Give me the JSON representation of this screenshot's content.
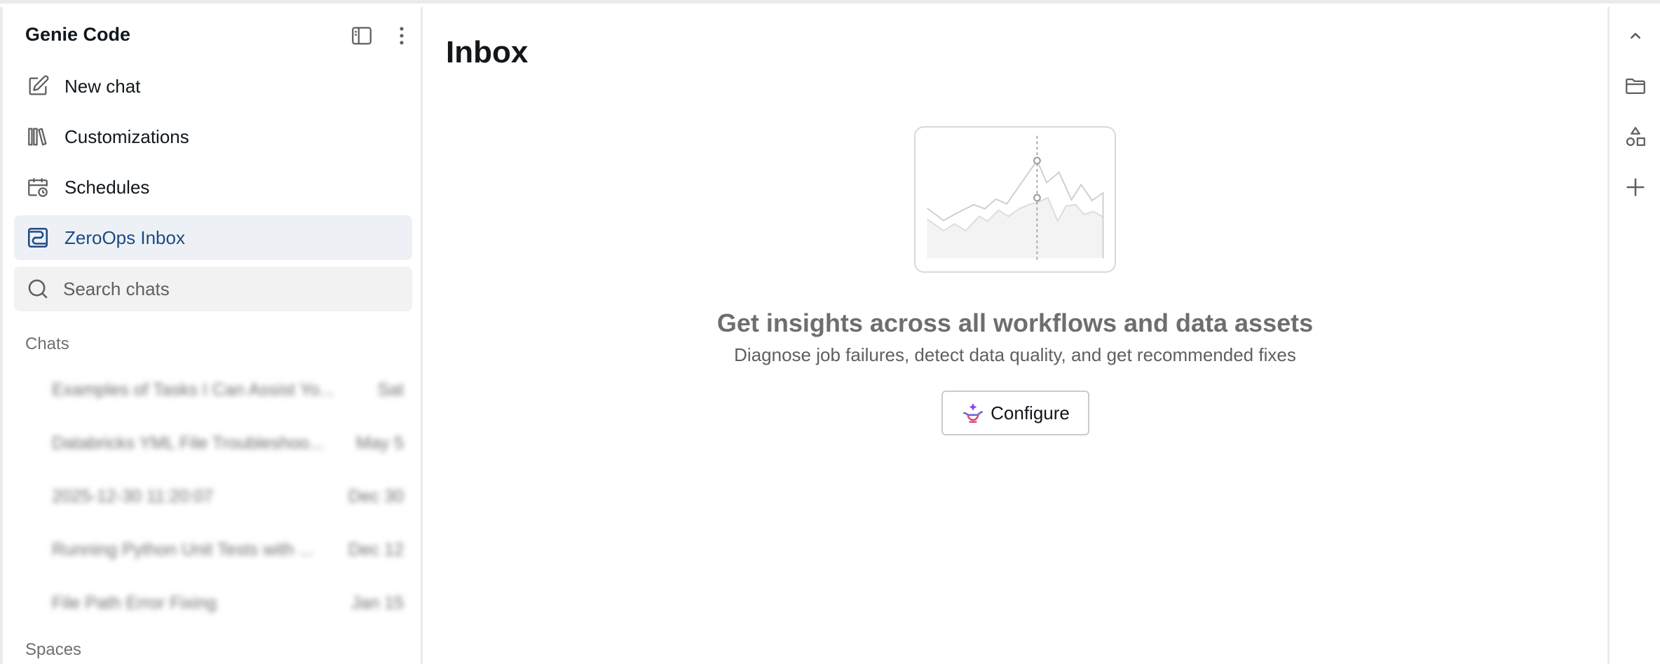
{
  "sidebar": {
    "title": "Genie Code",
    "header_icons": [
      "sidebar-toggle-icon",
      "more-vertical-icon"
    ],
    "nav": [
      {
        "label": "New chat",
        "icon": "edit-icon"
      },
      {
        "label": "Customizations",
        "icon": "library-icon"
      },
      {
        "label": "Schedules",
        "icon": "calendar-clock-icon"
      },
      {
        "label": "ZeroOps Inbox",
        "icon": "inbox-icon",
        "active": true
      }
    ],
    "search": {
      "placeholder": "Search chats",
      "value": ""
    },
    "sections": {
      "chats": "Chats",
      "spaces": "Spaces"
    },
    "chats": [
      {
        "title": "Examples of Tasks I Can Assist Yo...",
        "date": "Sat"
      },
      {
        "title": "Databricks YML File Troubleshoo...",
        "date": "May 5"
      },
      {
        "title": "2025-12-30 11:20:07",
        "date": "Dec 30"
      },
      {
        "title": "Running Python Unit Tests with ...",
        "date": "Dec 12"
      },
      {
        "title": "File Path Error Fixing",
        "date": "Jan 15"
      }
    ]
  },
  "main": {
    "title": "Inbox",
    "empty_state": {
      "illustration": "line-chart-illustration",
      "title": "Get insights across all workflows and data assets",
      "subtitle": "Diagnose job failures, detect data quality, and get recommended fixes",
      "button_label": "Configure",
      "button_icon": "genie-lamp-icon"
    }
  },
  "rail": {
    "icons": [
      "chevron-up-icon",
      "folder-icon",
      "shapes-icon",
      "plus-icon"
    ]
  },
  "colors": {
    "active_bg": "#edf1f6",
    "active_text": "#1e4a83",
    "border": "#ebebeb",
    "muted_text": "#6f6f6f"
  }
}
